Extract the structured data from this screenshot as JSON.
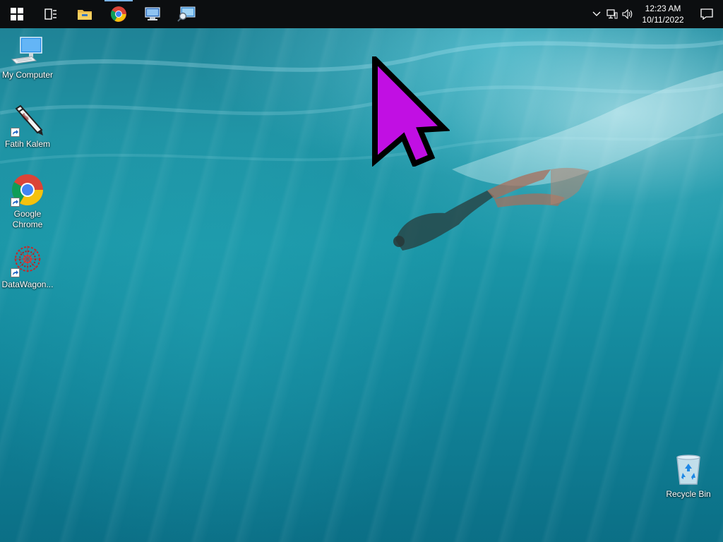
{
  "taskbar": {
    "buttons": [
      {
        "name": "start-button",
        "icon": "windows-logo-icon"
      },
      {
        "name": "task-view-button",
        "icon": "task-view-icon"
      },
      {
        "name": "file-explorer-button",
        "icon": "folder-icon"
      },
      {
        "name": "chrome-taskbar-button",
        "icon": "chrome-icon",
        "active": true
      },
      {
        "name": "remote-desktop-taskbar-button",
        "icon": "remote-desktop-icon"
      },
      {
        "name": "network-search-taskbar-button",
        "icon": "monitor-magnifier-icon"
      }
    ],
    "tray": {
      "icons": [
        "chevron-up-icon",
        "network-icon",
        "volume-icon"
      ],
      "time": "12:23 AM",
      "date": "10/11/2022",
      "notification_icon": "action-center-icon"
    }
  },
  "desktop": {
    "icons": [
      {
        "label": "My Computer",
        "icon": "computer-icon",
        "shortcut": false
      },
      {
        "label": "Fatih Kalem",
        "icon": "pen-icon",
        "shortcut": true
      },
      {
        "label": "Google Chrome",
        "icon": "chrome-icon",
        "shortcut": true
      },
      {
        "label": "DataWagon...",
        "icon": "datawagon-icon",
        "shortcut": true
      },
      {
        "label": "Recycle Bin",
        "icon": "recycle-bin-icon",
        "shortcut": false
      }
    ]
  },
  "colors": {
    "taskbar": "#0c0e10",
    "cursor_fill": "#c10fe3",
    "water_top": "#1f7f93",
    "water_bottom": "#0b6f86"
  }
}
